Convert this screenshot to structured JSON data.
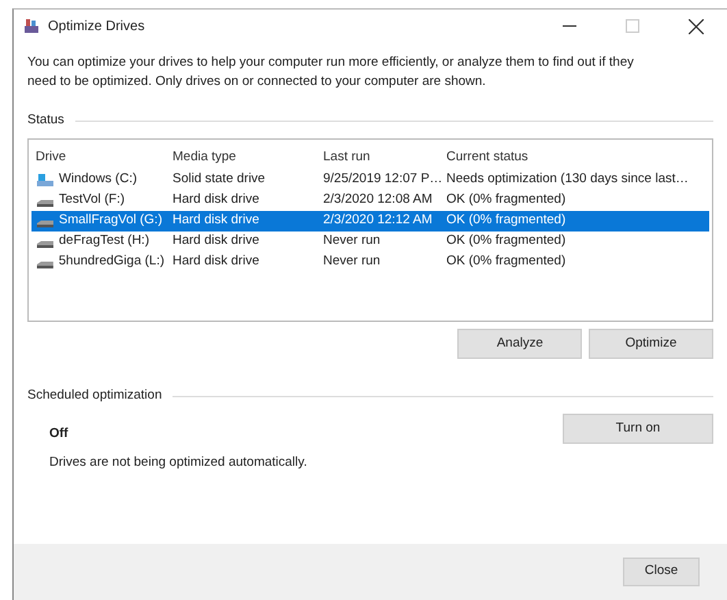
{
  "window": {
    "title": "Optimize Drives",
    "maximize_disabled": true
  },
  "description": "You can optimize your drives to help your computer run more efficiently, or analyze them to find out if they need to be optimized. Only drives on or connected to your computer are shown.",
  "status_section": {
    "title": "Status"
  },
  "table": {
    "columns": [
      "Drive",
      "Media type",
      "Last run",
      "Current status"
    ],
    "rows": [
      {
        "kind": "ssd",
        "selected": false,
        "cells": [
          "Windows (C:)",
          "Solid state drive",
          "9/25/2019 12:07 P…",
          "Needs optimization (130 days since last…"
        ]
      },
      {
        "kind": "hdd",
        "selected": false,
        "cells": [
          "TestVol (F:)",
          "Hard disk drive",
          "2/3/2020 12:08 AM",
          "OK (0% fragmented)"
        ]
      },
      {
        "kind": "hdd",
        "selected": true,
        "cells": [
          "SmallFragVol (G:)",
          "Hard disk drive",
          "2/3/2020 12:12 AM",
          "OK (0% fragmented)"
        ]
      },
      {
        "kind": "hdd",
        "selected": false,
        "cells": [
          "deFragTest (H:)",
          "Hard disk drive",
          "Never run",
          "OK (0% fragmented)"
        ]
      },
      {
        "kind": "hdd",
        "selected": false,
        "cells": [
          "5hundredGiga (L:)",
          "Hard disk drive",
          "Never run",
          "OK (0% fragmented)"
        ]
      }
    ]
  },
  "actions": [
    "Analyze",
    "Optimize"
  ],
  "scheduled": {
    "title": "Scheduled optimization",
    "state": "Off",
    "message": "Drives are not being optimized automatically.",
    "button": "Turn on"
  },
  "footer": {
    "button": "Close"
  }
}
